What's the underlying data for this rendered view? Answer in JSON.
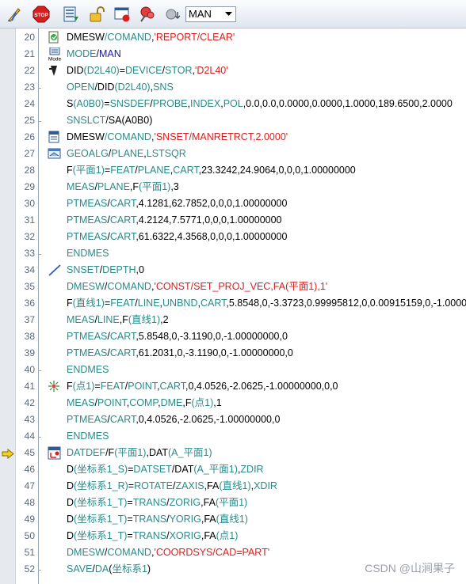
{
  "toolbar": {
    "mode_value": "MAN",
    "buttons": [
      "edit-pen-icon",
      "stop-icon",
      "list-steps-icon",
      "unlock-icon",
      "window-record-icon",
      "pushpin-icon",
      "probe-down-icon"
    ]
  },
  "watermark": "CSDN @山涧果子",
  "lines": [
    {
      "num": "20",
      "icon": "report-icon",
      "parts": [
        [
          "n",
          "DMESW"
        ],
        [
          "k",
          "/"
        ],
        [
          "k",
          "COMAND"
        ],
        [
          "n",
          ","
        ],
        [
          "s",
          "'REPORT/CLEAR'"
        ]
      ]
    },
    {
      "num": "21",
      "icon": "mode-icon",
      "parts": [
        [
          "k",
          "MODE"
        ],
        [
          "n",
          "/"
        ],
        [
          "t",
          "MAN"
        ]
      ]
    },
    {
      "num": "22",
      "icon": "device-icon",
      "parts": [
        [
          "n",
          "DID"
        ],
        [
          "k",
          "(D2L40)"
        ],
        [
          "n",
          "="
        ],
        [
          "k",
          "DEVICE"
        ],
        [
          "n",
          "/"
        ],
        [
          "k",
          "STOR"
        ],
        [
          "n",
          ","
        ],
        [
          "s",
          "'D2L40'"
        ]
      ]
    },
    {
      "num": "23",
      "icon": "",
      "parts": [
        [
          "k",
          "OPEN"
        ],
        [
          "n",
          "/DID"
        ],
        [
          "k",
          "(D2L40)"
        ],
        [
          "n",
          ","
        ],
        [
          "k",
          "SNS"
        ]
      ]
    },
    {
      "num": "24",
      "icon": "",
      "parts": [
        [
          "n",
          "S"
        ],
        [
          "k",
          "(A0B0)"
        ],
        [
          "n",
          "="
        ],
        [
          "k",
          "SNSDEF"
        ],
        [
          "n",
          "/"
        ],
        [
          "k",
          "PROBE"
        ],
        [
          "n",
          ","
        ],
        [
          "k",
          "INDEX"
        ],
        [
          "n",
          ","
        ],
        [
          "k",
          "POL"
        ],
        [
          "n",
          ",0.0,0.0,0.0000,0.0000,1.0000,189.6500,2.0000"
        ]
      ]
    },
    {
      "num": "25",
      "icon": "",
      "parts": [
        [
          "k",
          "SNSLCT"
        ],
        [
          "n",
          "/SA(A0B0)"
        ]
      ]
    },
    {
      "num": "26",
      "icon": "snset-icon",
      "parts": [
        [
          "n",
          "DMESW"
        ],
        [
          "k",
          "/"
        ],
        [
          "k",
          "COMAND"
        ],
        [
          "n",
          ","
        ],
        [
          "s",
          "'SNSET/MANRETRCT,2.0000'"
        ]
      ]
    },
    {
      "num": "27",
      "icon": "plane-icon",
      "parts": [
        [
          "k",
          "GEOALG"
        ],
        [
          "n",
          "/"
        ],
        [
          "k",
          "PLANE"
        ],
        [
          "n",
          ","
        ],
        [
          "k",
          "LSTSQR"
        ]
      ]
    },
    {
      "num": "28",
      "icon": "",
      "parts": [
        [
          "n",
          "F"
        ],
        [
          "k",
          "(平面1)"
        ],
        [
          "n",
          "="
        ],
        [
          "k",
          "FEAT"
        ],
        [
          "n",
          "/"
        ],
        [
          "k",
          "PLANE"
        ],
        [
          "n",
          ","
        ],
        [
          "k",
          "CART"
        ],
        [
          "n",
          ",23.3242,24.9064,0,0,0,1.00000000"
        ]
      ]
    },
    {
      "num": "29",
      "icon": "",
      "parts": [
        [
          "k",
          "MEAS"
        ],
        [
          "n",
          "/"
        ],
        [
          "k",
          "PLANE"
        ],
        [
          "n",
          ",F"
        ],
        [
          "k",
          "(平面1)"
        ],
        [
          "n",
          ",3"
        ]
      ]
    },
    {
      "num": "30",
      "icon": "",
      "parts": [
        [
          "k",
          "PTMEAS"
        ],
        [
          "n",
          "/"
        ],
        [
          "k",
          "CART"
        ],
        [
          "n",
          ",4.1281,62.7852,0,0,0,1.00000000"
        ]
      ]
    },
    {
      "num": "31",
      "icon": "",
      "parts": [
        [
          "k",
          "PTMEAS"
        ],
        [
          "n",
          "/"
        ],
        [
          "k",
          "CART"
        ],
        [
          "n",
          ",4.2124,7.5771,0,0,0,1.00000000"
        ]
      ]
    },
    {
      "num": "32",
      "icon": "",
      "parts": [
        [
          "k",
          "PTMEAS"
        ],
        [
          "n",
          "/"
        ],
        [
          "k",
          "CART"
        ],
        [
          "n",
          ",61.6322,4.3568,0,0,0,1.00000000"
        ]
      ]
    },
    {
      "num": "33",
      "icon": "",
      "parts": [
        [
          "k",
          "ENDMES"
        ]
      ]
    },
    {
      "num": "34",
      "icon": "depth-icon",
      "parts": [
        [
          "k",
          "SNSET"
        ],
        [
          "n",
          "/"
        ],
        [
          "k",
          "DEPTH"
        ],
        [
          "n",
          ",0"
        ]
      ]
    },
    {
      "num": "35",
      "icon": "",
      "parts": [
        [
          "k",
          "DMESW"
        ],
        [
          "n",
          "/"
        ],
        [
          "k",
          "COMAND"
        ],
        [
          "n",
          ","
        ],
        [
          "s",
          "'CONST/SET_PROJ_VEC,FA(平面1),1'"
        ]
      ]
    },
    {
      "num": "36",
      "icon": "",
      "parts": [
        [
          "n",
          "F"
        ],
        [
          "k",
          "(直线1)"
        ],
        [
          "n",
          "="
        ],
        [
          "k",
          "FEAT"
        ],
        [
          "n",
          "/"
        ],
        [
          "k",
          "LINE"
        ],
        [
          "n",
          ","
        ],
        [
          "k",
          "UNBND"
        ],
        [
          "n",
          ","
        ],
        [
          "k",
          "CART"
        ],
        [
          "n",
          ",5.8548,0,-3.3723,0.99995812,0,0.00915159,0,-1.00000"
        ]
      ]
    },
    {
      "num": "37",
      "icon": "",
      "parts": [
        [
          "k",
          "MEAS"
        ],
        [
          "n",
          "/"
        ],
        [
          "k",
          "LINE"
        ],
        [
          "n",
          ",F"
        ],
        [
          "k",
          "(直线1)"
        ],
        [
          "n",
          ",2"
        ]
      ]
    },
    {
      "num": "38",
      "icon": "",
      "parts": [
        [
          "k",
          "PTMEAS"
        ],
        [
          "n",
          "/"
        ],
        [
          "k",
          "CART"
        ],
        [
          "n",
          ",5.8548,0,-3.1190,0,-1.00000000,0"
        ]
      ]
    },
    {
      "num": "39",
      "icon": "",
      "parts": [
        [
          "k",
          "PTMEAS"
        ],
        [
          "n",
          "/"
        ],
        [
          "k",
          "CART"
        ],
        [
          "n",
          ",61.2031,0,-3.1190,0,-1.00000000,0"
        ]
      ]
    },
    {
      "num": "40",
      "icon": "",
      "parts": [
        [
          "k",
          "ENDMES"
        ]
      ]
    },
    {
      "num": "41",
      "icon": "point-icon",
      "parts": [
        [
          "n",
          "F"
        ],
        [
          "k",
          "(点1)"
        ],
        [
          "n",
          "="
        ],
        [
          "k",
          "FEAT"
        ],
        [
          "n",
          "/"
        ],
        [
          "k",
          "POINT"
        ],
        [
          "n",
          ","
        ],
        [
          "k",
          "CART"
        ],
        [
          "n",
          ",0,4.0526,-2.0625,-1.00000000,0,0"
        ]
      ]
    },
    {
      "num": "42",
      "icon": "",
      "parts": [
        [
          "k",
          "MEAS"
        ],
        [
          "n",
          "/"
        ],
        [
          "k",
          "POINT"
        ],
        [
          "n",
          ","
        ],
        [
          "k",
          "COMP"
        ],
        [
          "n",
          ","
        ],
        [
          "k",
          "DME"
        ],
        [
          "n",
          ",F"
        ],
        [
          "k",
          "(点1)"
        ],
        [
          "n",
          ",1"
        ]
      ]
    },
    {
      "num": "43",
      "icon": "",
      "parts": [
        [
          "k",
          "PTMEAS"
        ],
        [
          "n",
          "/"
        ],
        [
          "k",
          "CART"
        ],
        [
          "n",
          ",0,4.0526,-2.0625,-1.00000000,0"
        ]
      ]
    },
    {
      "num": "44",
      "icon": "",
      "parts": [
        [
          "k",
          "ENDMES"
        ]
      ]
    },
    {
      "num": "45",
      "icon": "datdef-icon",
      "parts": [
        [
          "k",
          "DATDEF"
        ],
        [
          "n",
          "/F"
        ],
        [
          "k",
          "(平面1)"
        ],
        [
          "n",
          ",DAT"
        ],
        [
          "k",
          "(A_平面1)"
        ]
      ]
    },
    {
      "num": "46",
      "icon": "",
      "parts": [
        [
          "n",
          "D"
        ],
        [
          "k",
          "(坐标系1_S)"
        ],
        [
          "n",
          "="
        ],
        [
          "k",
          "DATSET"
        ],
        [
          "n",
          "/DAT"
        ],
        [
          "k",
          "(A_平面1)"
        ],
        [
          "n",
          ","
        ],
        [
          "k",
          "ZDIR"
        ]
      ]
    },
    {
      "num": "47",
      "icon": "",
      "parts": [
        [
          "n",
          "D"
        ],
        [
          "k",
          "(坐标系1_R)"
        ],
        [
          "n",
          "="
        ],
        [
          "k",
          "ROTATE"
        ],
        [
          "n",
          "/"
        ],
        [
          "k",
          "ZAXIS"
        ],
        [
          "n",
          ",FA"
        ],
        [
          "k",
          "(直线1)"
        ],
        [
          "n",
          ","
        ],
        [
          "k",
          "XDIR"
        ]
      ]
    },
    {
      "num": "48",
      "icon": "",
      "parts": [
        [
          "n",
          "D"
        ],
        [
          "k",
          "(坐标系1_T)"
        ],
        [
          "n",
          "="
        ],
        [
          "k",
          "TRANS"
        ],
        [
          "n",
          "/"
        ],
        [
          "k",
          "ZORIG"
        ],
        [
          "n",
          ",FA"
        ],
        [
          "k",
          "(平面1)"
        ]
      ]
    },
    {
      "num": "49",
      "icon": "",
      "parts": [
        [
          "n",
          "D"
        ],
        [
          "k",
          "(坐标系1_T)"
        ],
        [
          "n",
          "="
        ],
        [
          "k",
          "TRANS"
        ],
        [
          "n",
          "/"
        ],
        [
          "k",
          "YORIG"
        ],
        [
          "n",
          ",FA"
        ],
        [
          "k",
          "(直线1)"
        ]
      ]
    },
    {
      "num": "50",
      "icon": "",
      "parts": [
        [
          "n",
          "D"
        ],
        [
          "k",
          "(坐标系1_T)"
        ],
        [
          "n",
          "="
        ],
        [
          "k",
          "TRANS"
        ],
        [
          "n",
          "/"
        ],
        [
          "k",
          "XORIG"
        ],
        [
          "n",
          ",FA"
        ],
        [
          "k",
          "(点1)"
        ]
      ]
    },
    {
      "num": "51",
      "icon": "",
      "parts": [
        [
          "k",
          "DMESW"
        ],
        [
          "n",
          "/"
        ],
        [
          "k",
          "COMAND"
        ],
        [
          "n",
          ","
        ],
        [
          "s",
          "'COORDSYS/CAD=PART'"
        ]
      ]
    },
    {
      "num": "52",
      "icon": "",
      "parts": [
        [
          "k",
          "SAVE"
        ],
        [
          "n",
          "/"
        ],
        [
          "k",
          "DA"
        ],
        [
          "n",
          "("
        ],
        [
          "k",
          "坐标系1"
        ],
        [
          "n",
          ")"
        ]
      ]
    }
  ],
  "current_line": "45"
}
